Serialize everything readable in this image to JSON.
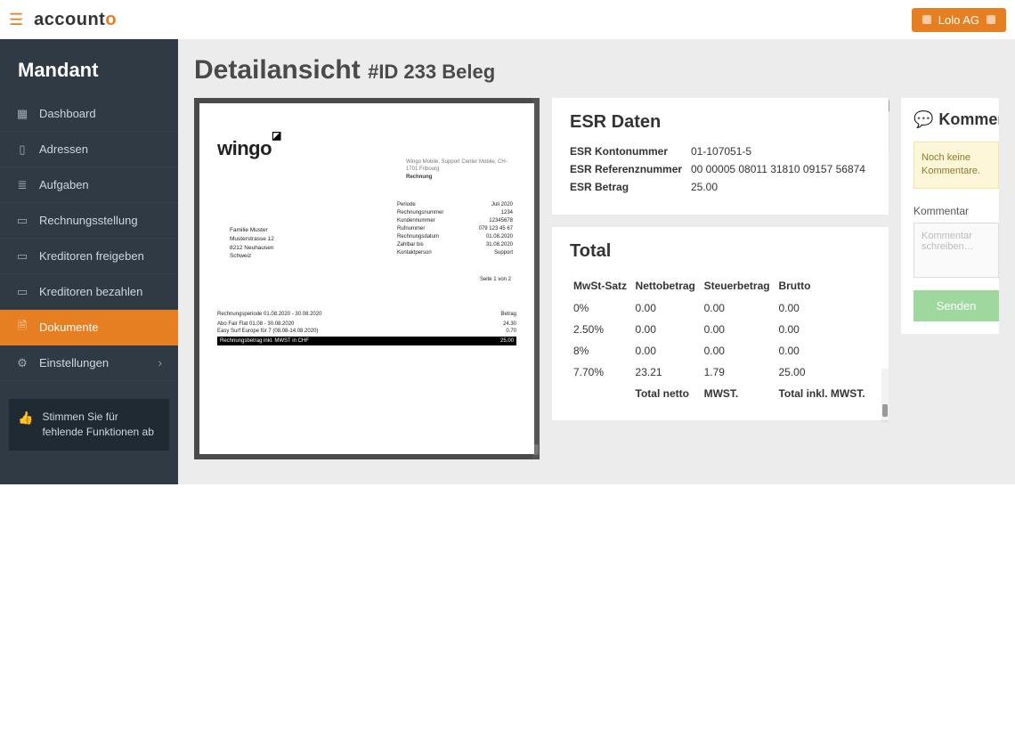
{
  "brand": {
    "name_black": "account",
    "name_orange": "o"
  },
  "user_pill": "Lolo AG",
  "sidebar": {
    "title": "Mandant",
    "items": [
      {
        "label": "Dashboard"
      },
      {
        "label": "Adressen"
      },
      {
        "label": "Aufgaben"
      },
      {
        "label": "Rechnungsstellung"
      },
      {
        "label": "Kreditoren freigeben"
      },
      {
        "label": "Kreditoren bezahlen"
      },
      {
        "label": "Dokumente"
      },
      {
        "label": "Einstellungen"
      }
    ],
    "vote": "Stimmen Sie für fehlende Funktionen ab"
  },
  "page_title_main": "Detailansicht",
  "page_title_sub": "#ID 233 Beleg",
  "document_preview": {
    "logo": "wingo",
    "header_right_line1": "Wingo Mobile, Support Center Mobile, CH-1701 Fribourg",
    "header_right_line2": "Rechnung",
    "addr_left_l1": "Familie Muster",
    "addr_left_l2": "Musterstrasse 12",
    "addr_left_l3": "8212 Neuhausen",
    "addr_left_l4": "Schweiz",
    "meta_rows": [
      {
        "k": "Periode",
        "v": "Juli 2020"
      },
      {
        "k": "Rechnungsnummer",
        "v": "1234"
      },
      {
        "k": "Kundennummer",
        "v": "12345678"
      },
      {
        "k": "Rufnummer",
        "v": "079 123 45 67"
      },
      {
        "k": "Rechnungsdatum",
        "v": "01.08.2020"
      },
      {
        "k": "Zahlbar bis",
        "v": "31.08.2020"
      },
      {
        "k": "Kontaktperson",
        "v": "Support"
      }
    ],
    "page_no": "Seite 1 von 2",
    "period_header": "Rechnungsperiode 01.08.2020 - 30.08.2020",
    "col_amount": "Betrag",
    "lines": [
      {
        "desc": "Abo Fair Flat 01.08 - 30.08.2020",
        "amt": "24.30"
      },
      {
        "desc": "Easy Surf Europe für 7 (08.08-14.08.2020)",
        "amt": "0.70"
      }
    ],
    "total_label": "Rechnungsbetrag inkl. MWST in CHF",
    "total_value": "25.00"
  },
  "esr": {
    "title": "ESR Daten",
    "rows": [
      {
        "label": "ESR Kontonummer",
        "value": "01-107051-5"
      },
      {
        "label": "ESR Referenznummer",
        "value": "00 00005 08011 31810 09157 56874"
      },
      {
        "label": "ESR Betrag",
        "value": "25.00"
      }
    ]
  },
  "totals": {
    "title": "Total",
    "headers": {
      "rate": "MwSt-Satz",
      "net": "Nettobetrag",
      "tax": "Steuerbetrag",
      "gross": "Brutto"
    },
    "rows": [
      {
        "rate": "0%",
        "net": "0.00",
        "tax": "0.00",
        "gross": "0.00"
      },
      {
        "rate": "2.50%",
        "net": "0.00",
        "tax": "0.00",
        "gross": "0.00"
      },
      {
        "rate": "8%",
        "net": "0.00",
        "tax": "0.00",
        "gross": "0.00"
      },
      {
        "rate": "7.70%",
        "net": "23.21",
        "tax": "1.79",
        "gross": "25.00"
      }
    ],
    "footer": {
      "net": "Total netto",
      "tax": "MWST.",
      "gross": "Total inkl. MWST."
    }
  },
  "comments": {
    "title": "Komment",
    "empty": "Noch keine Kommentare.",
    "label": "Kommentar",
    "placeholder": "Kommentar schreiben…",
    "send": "Senden"
  }
}
